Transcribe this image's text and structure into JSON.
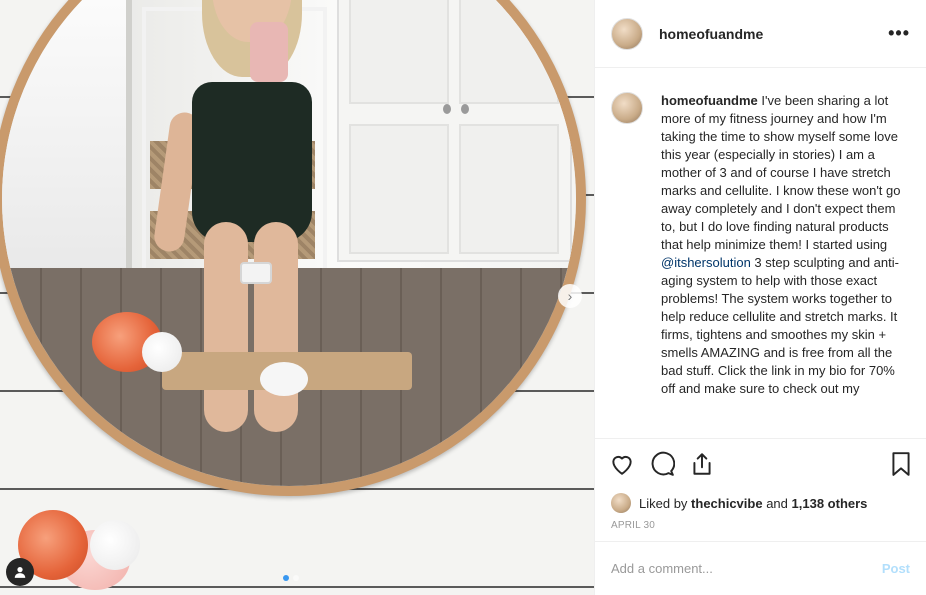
{
  "post": {
    "username": "homeofuandme",
    "caption_user": "homeofuandme",
    "caption_before": " I've been sharing a lot more of my fitness journey and how I'm taking the time to show myself some love this year (especially in stories) I am a mother of 3 and of course I have stretch marks and cellulite. I know these won't go away completely and I don't expect them to, but I do love finding natural products that help minimize them! I started using ",
    "caption_mention": "@itshersolution",
    "caption_after": " 3 step sculpting and anti-aging system to help with those exact problems! The system works together to help reduce cellulite and stretch marks. It firms, tightens and smoothes my skin + smells AMAZING and is free from all the bad stuff. Click the link in my bio for 70% off and make sure to check out my",
    "likes_prefix": "Liked by ",
    "likes_user": "thechicvibe",
    "likes_mid": " and ",
    "likes_count": "1,138 others",
    "date": "APRIL 30",
    "comment_placeholder": "Add a comment...",
    "post_label": "Post"
  },
  "icons": {
    "more": "more-options-icon",
    "like": "heart-icon",
    "comment": "comment-icon",
    "share": "share-icon",
    "save": "bookmark-icon",
    "next": "chevron-right-icon",
    "user_tag": "user-tag-icon"
  },
  "carousel": {
    "total": 2,
    "active": 0
  },
  "colors": {
    "link": "#003569",
    "post_disabled": "#b2dffc",
    "carousel_active": "#3897f0"
  }
}
